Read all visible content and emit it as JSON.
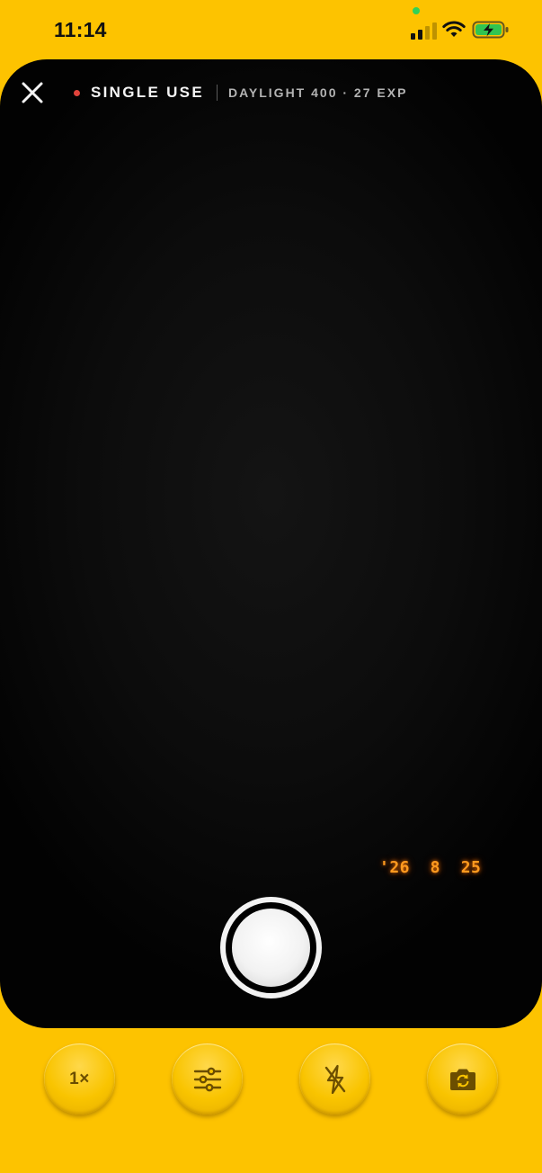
{
  "status_bar": {
    "time": "11:14",
    "privacy_indicator_color": "#31D158",
    "icons": [
      "cellular-signal-icon",
      "wifi-icon",
      "battery-charging-icon"
    ]
  },
  "viewfinder": {
    "close_icon": "close-icon",
    "recording_dot_color": "#E0433B",
    "film_title": "SINGLE USE",
    "film_info": "DAYLIGHT 400 · 27 EXP",
    "date_stamp": "'26  8  25",
    "date_stamp_color": "#FF9A1F",
    "shutter_icon": "shutter-button"
  },
  "controls": {
    "zoom_label": "1×",
    "settings_icon": "sliders-icon",
    "flash_icon": "flash-off-icon",
    "flip_icon": "camera-flip-icon"
  },
  "colors": {
    "background": "#FDC300",
    "viewfinder": "#0A0A0A",
    "control_icon": "#6B4E00"
  }
}
